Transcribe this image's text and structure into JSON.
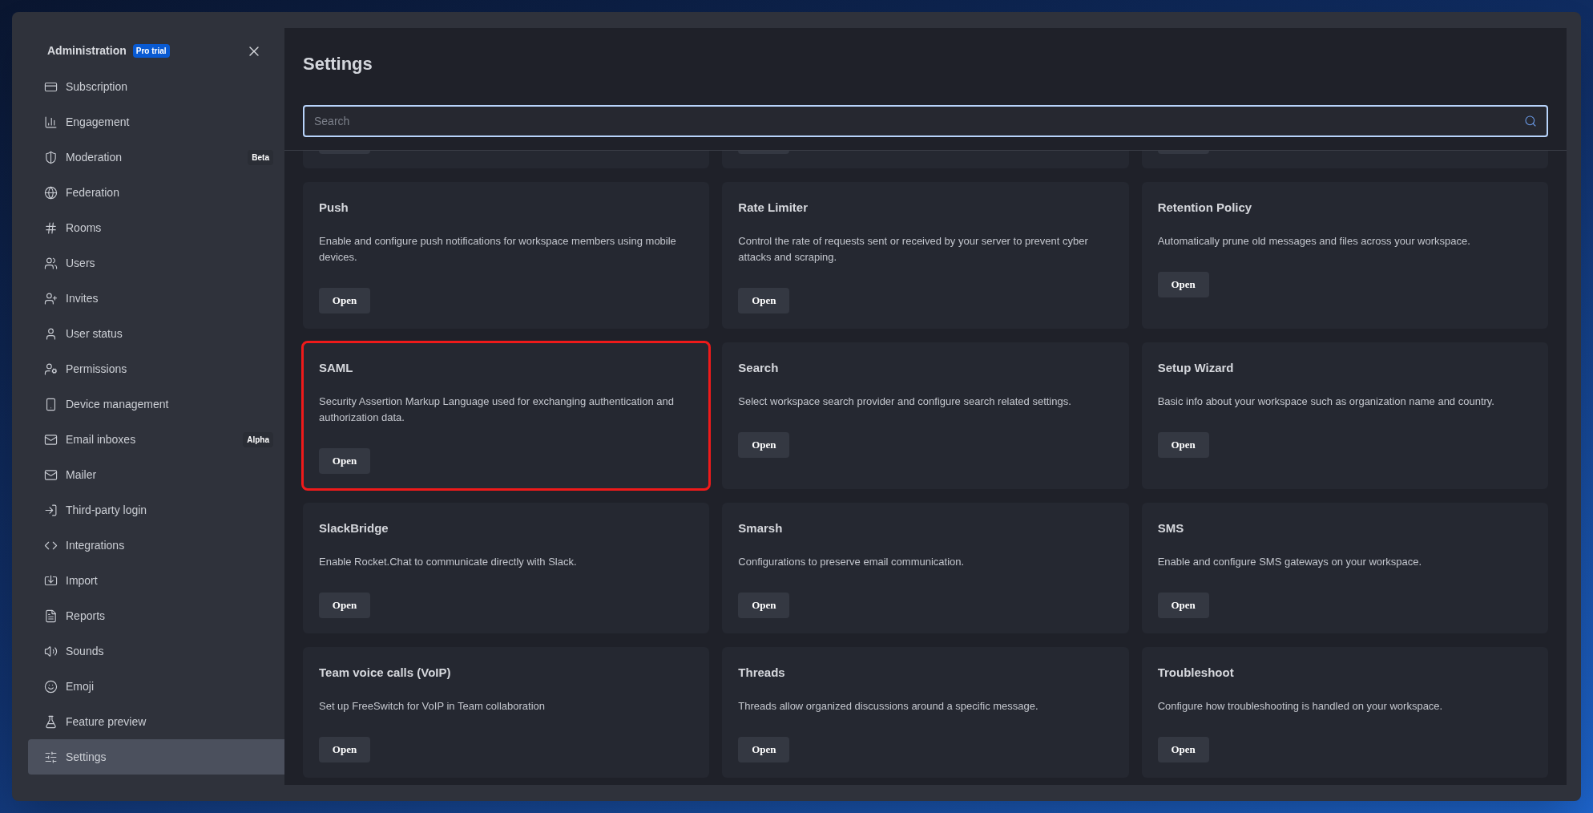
{
  "sidebar": {
    "title": "Administration",
    "badge": "Pro trial",
    "items": [
      {
        "label": "Subscription",
        "selected": false
      },
      {
        "label": "Engagement",
        "selected": false
      },
      {
        "label": "Moderation",
        "badge": "Beta",
        "selected": false
      },
      {
        "label": "Federation",
        "selected": false
      },
      {
        "label": "Rooms",
        "selected": false
      },
      {
        "label": "Users",
        "selected": false
      },
      {
        "label": "Invites",
        "selected": false
      },
      {
        "label": "User status",
        "selected": false
      },
      {
        "label": "Permissions",
        "selected": false
      },
      {
        "label": "Device management",
        "selected": false
      },
      {
        "label": "Email inboxes",
        "badge": "Alpha",
        "selected": false
      },
      {
        "label": "Mailer",
        "selected": false
      },
      {
        "label": "Third-party login",
        "selected": false
      },
      {
        "label": "Integrations",
        "selected": false
      },
      {
        "label": "Import",
        "selected": false
      },
      {
        "label": "Reports",
        "selected": false
      },
      {
        "label": "Sounds",
        "selected": false
      },
      {
        "label": "Emoji",
        "selected": false
      },
      {
        "label": "Feature preview",
        "selected": false
      },
      {
        "label": "Settings",
        "selected": true
      }
    ]
  },
  "main": {
    "title": "Settings",
    "search": {
      "placeholder": "Search"
    },
    "cards": [
      {
        "title": "Push",
        "description": "Enable and configure push notifications for workspace members using mobile devices.",
        "button": "Open",
        "highlighted": false
      },
      {
        "title": "Rate Limiter",
        "description": "Control the rate of requests sent or received by your server to prevent cyber attacks and scraping.",
        "button": "Open",
        "highlighted": false
      },
      {
        "title": "Retention Policy",
        "description": "Automatically prune old messages and files across your workspace.",
        "button": "Open",
        "highlighted": false
      },
      {
        "title": "SAML",
        "description": "Security Assertion Markup Language used for exchanging authentication and authorization data.",
        "button": "Open",
        "highlighted": true
      },
      {
        "title": "Search",
        "description": "Select workspace search provider and configure search related settings.",
        "button": "Open",
        "highlighted": false
      },
      {
        "title": "Setup Wizard",
        "description": "Basic info about your workspace such as organization name and country.",
        "button": "Open",
        "highlighted": false
      },
      {
        "title": "SlackBridge",
        "description": "Enable Rocket.Chat to communicate directly with Slack.",
        "button": "Open",
        "highlighted": false
      },
      {
        "title": "Smarsh",
        "description": "Configurations to preserve email communication.",
        "button": "Open",
        "highlighted": false
      },
      {
        "title": "SMS",
        "description": "Enable and configure SMS gateways on your workspace.",
        "button": "Open",
        "highlighted": false
      },
      {
        "title": "Team voice calls (VoIP)",
        "description": "Set up FreeSwitch for VoIP in Team collaboration",
        "button": "Open",
        "highlighted": false
      },
      {
        "title": "Threads",
        "description": "Threads allow organized discussions around a specific message.",
        "button": "Open",
        "highlighted": false
      },
      {
        "title": "Troubleshoot",
        "description": "Configure how troubleshooting is handled on your workspace.",
        "button": "Open",
        "highlighted": false
      }
    ]
  }
}
